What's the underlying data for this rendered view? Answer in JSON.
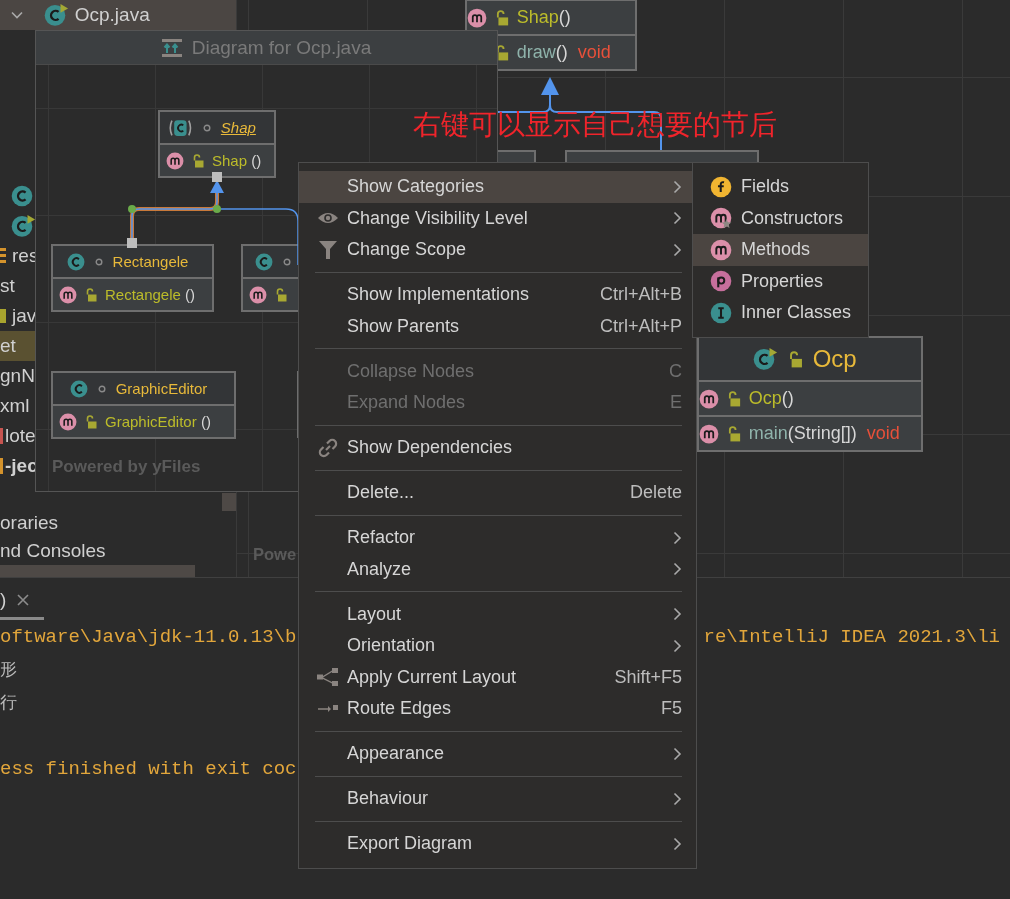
{
  "project_tree": {
    "groups": [
      [
        {
          "label": "Ocp.java",
          "kind": "main-class",
          "expanded": true,
          "selected": true
        }
      ],
      [
        {
          "kind": "class",
          "selected": false
        },
        {
          "kind": "main-class",
          "selected": false
        },
        {
          "label": "res",
          "kind": "resources",
          "selected": false
        },
        {
          "label": "st",
          "kind": "plain",
          "selected": false
        },
        {
          "label": "jav",
          "kind": "folder",
          "selected": false
        },
        {
          "label": "et",
          "kind": "excluded",
          "selected": false
        },
        {
          "label": "gnN",
          "kind": "plain",
          "selected": false
        },
        {
          "label": "xml",
          "kind": "plain",
          "selected": false
        },
        {
          "label": "lote",
          "kind": "file",
          "selected": false
        },
        {
          "label": "-jec",
          "kind": "module",
          "selected": false
        }
      ],
      [
        {
          "label": "oraries",
          "kind": "plain",
          "selected": false
        },
        {
          "label": "nd Consoles",
          "kind": "plain",
          "selected": false
        }
      ]
    ]
  },
  "canvas": {
    "nodes": [
      {
        "members": [
          {
            "kind": "constructor",
            "public": true,
            "name": "Shap",
            "params": "()"
          },
          {
            "kind": "method",
            "public": true,
            "name": "draw",
            "params": "()",
            "returns": "void"
          }
        ]
      },
      {
        "name": "Ocp",
        "kind": "main-class",
        "public": true,
        "members": [
          {
            "kind": "constructor",
            "public": true,
            "name": "Ocp",
            "params": "()"
          },
          {
            "kind": "method",
            "public": true,
            "name": "main",
            "params": "(String[])",
            "returns": "void"
          }
        ]
      }
    ],
    "footer": "Powe",
    "annotation": "右键可以显示自己想要的节后"
  },
  "diagram_popup": {
    "title": "Diagram for Ocp.java",
    "nodes": [
      {
        "name": "Shap",
        "kind": "abstract",
        "public": false,
        "members": [
          {
            "kind": "constructor",
            "public": true,
            "name": "Shap",
            "params": " ()"
          }
        ]
      },
      {
        "name": "Rectangele",
        "kind": "class",
        "public": false,
        "members": [
          {
            "kind": "constructor",
            "public": true,
            "name": "Rectangele",
            "params": " ()"
          }
        ]
      },
      {
        "kind": "class",
        "public": false,
        "members": [
          {
            "kind": "constructor",
            "public": true
          }
        ]
      },
      {
        "name": "GraphicEditor",
        "kind": "class",
        "public": false,
        "members": [
          {
            "kind": "constructor",
            "public": true,
            "name": "GraphicEditor",
            "params": " ()"
          }
        ]
      }
    ],
    "footer": "Powered by yFiles"
  },
  "context_menu": {
    "groups": [
      [
        {
          "label": "Show Categories",
          "kind": "plain",
          "submenu": true,
          "selected": true,
          "disabled": false
        },
        {
          "label": "Change Visibility Level",
          "kind": "visibility",
          "submenu": true,
          "selected": false,
          "disabled": false
        },
        {
          "label": "Change Scope",
          "kind": "scope",
          "submenu": true,
          "selected": false,
          "disabled": false
        }
      ],
      [
        {
          "label": "Show Implementations",
          "shortcut": "Ctrl+Alt+B",
          "kind": "plain",
          "submenu": false,
          "selected": false,
          "disabled": false
        },
        {
          "label": "Show Parents",
          "shortcut": "Ctrl+Alt+P",
          "kind": "plain",
          "submenu": false,
          "selected": false,
          "disabled": false
        }
      ],
      [
        {
          "label": "Collapse Nodes",
          "shortcut": "C",
          "kind": "plain",
          "submenu": false,
          "selected": false,
          "disabled": true
        },
        {
          "label": "Expand Nodes",
          "shortcut": "E",
          "kind": "plain",
          "submenu": false,
          "selected": false,
          "disabled": true
        }
      ],
      [
        {
          "label": "Show Dependencies",
          "kind": "dependencies",
          "submenu": false,
          "selected": false,
          "disabled": false
        }
      ],
      [
        {
          "label": "Delete...",
          "shortcut": "Delete",
          "kind": "plain",
          "submenu": false,
          "selected": false,
          "disabled": false
        }
      ],
      [
        {
          "label": "Refactor",
          "kind": "plain",
          "submenu": true,
          "selected": false,
          "disabled": false
        },
        {
          "label": "Analyze",
          "kind": "plain",
          "submenu": true,
          "selected": false,
          "disabled": false
        }
      ],
      [
        {
          "label": "Layout",
          "kind": "plain",
          "submenu": true,
          "selected": false,
          "disabled": false
        },
        {
          "label": "Orientation",
          "kind": "plain",
          "submenu": true,
          "selected": false,
          "disabled": false
        },
        {
          "label": "Apply Current Layout",
          "shortcut": "Shift+F5",
          "kind": "layout",
          "submenu": false,
          "selected": false,
          "disabled": false
        },
        {
          "label": "Route Edges",
          "shortcut": "F5",
          "kind": "route",
          "submenu": false,
          "selected": false,
          "disabled": false
        }
      ],
      [
        {
          "label": "Appearance",
          "kind": "plain",
          "submenu": true,
          "selected": false,
          "disabled": false
        }
      ],
      [
        {
          "label": "Behaviour",
          "kind": "plain",
          "submenu": true,
          "selected": false,
          "disabled": false
        }
      ],
      [
        {
          "label": "Export Diagram",
          "kind": "plain",
          "submenu": true,
          "selected": false,
          "disabled": false
        }
      ]
    ]
  },
  "categories_menu": {
    "items": [
      {
        "label": "Fields",
        "kind": "field",
        "selected": false
      },
      {
        "label": "Constructors",
        "kind": "constructor",
        "selected": false
      },
      {
        "label": "Methods",
        "kind": "method",
        "selected": true
      },
      {
        "label": "Properties",
        "kind": "property",
        "selected": false
      },
      {
        "label": "Inner Classes",
        "kind": "inner-class",
        "selected": false
      }
    ]
  },
  "console": {
    "tab": {
      "label": ")",
      "selected": true
    },
    "lines": [
      {
        "kind": "command",
        "parts": [
          "oftware\\Java\\jdk-11.0.13\\b",
          "re\\IntelliJ IDEA 2021.3\\li"
        ]
      },
      {
        "kind": "output",
        "parts": [
          "形"
        ]
      },
      {
        "kind": "output",
        "parts": [
          "行"
        ]
      },
      {
        "kind": "exit",
        "parts": [
          "ess finished with exit coc"
        ]
      }
    ]
  }
}
